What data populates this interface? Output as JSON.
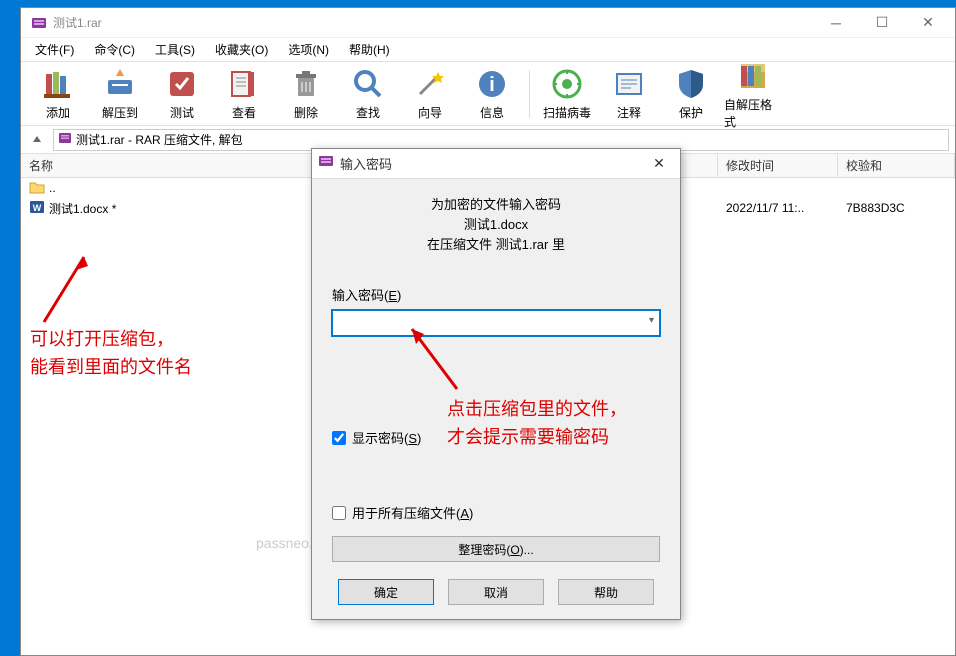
{
  "window": {
    "title": "测试1.rar"
  },
  "menubar": {
    "file": "文件(F)",
    "commands": "命令(C)",
    "tools": "工具(S)",
    "favorites": "收藏夹(O)",
    "options": "选项(N)",
    "help": "帮助(H)"
  },
  "toolbar": {
    "add": "添加",
    "extract": "解压到",
    "test": "测试",
    "view": "查看",
    "delete": "删除",
    "find": "查找",
    "wizard": "向导",
    "info": "信息",
    "scan": "扫描病毒",
    "comment": "注释",
    "protect": "保护",
    "sfx": "自解压格式"
  },
  "path": {
    "text": "测试1.rar - RAR 压缩文件, 解包"
  },
  "columns": {
    "name": "名称",
    "mtime": "修改时间",
    "checksum": "校验和"
  },
  "files": [
    {
      "name": "..",
      "mtime": "",
      "checksum": "",
      "type": "folder"
    },
    {
      "name": "测试1.docx *",
      "mtime": "2022/11/7 11:..",
      "checksum": "7B883D3C",
      "type": "word"
    }
  ],
  "annotations": {
    "left_line1": "可以打开压缩包，",
    "left_line2": "能看到里面的文件名",
    "right_line1": "点击压缩包里的文件，",
    "right_line2": "才会提示需要输密码"
  },
  "dialog": {
    "title": "输入密码",
    "intro1": "为加密的文件输入密码",
    "intro2": "测试1.docx",
    "intro3": "在压缩文件 测试1.rar 里",
    "password_label_pre": "输入密码(",
    "password_label_key": "E",
    "password_label_post": ")",
    "show_pre": "显示密码(",
    "show_key": "S",
    "show_post": ")",
    "allarch_pre": "用于所有压缩文件(",
    "allarch_key": "A",
    "allarch_post": ")",
    "organize_pre": "整理密码(",
    "organize_key": "O",
    "organize_post": ")...",
    "ok": "确定",
    "cancel": "取消",
    "help": "帮助"
  },
  "watermark": "passneo.cn"
}
